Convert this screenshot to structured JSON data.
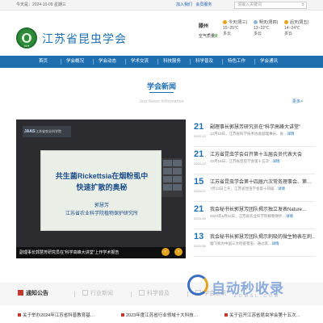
{
  "topbar": {
    "date": "今天是：2024-10-09 星期三",
    "links": [
      "加入我们",
      "会员服务"
    ],
    "search_placeholder": "请输入关键词"
  },
  "header": {
    "site_title": "江苏省昆虫学会",
    "logo_year": "1978",
    "weather": {
      "city": "滕州",
      "air_quality_label": "空气质量",
      "air_quality_value": "良",
      "days": [
        {
          "name": "今天(周三)",
          "temp": "15~25℃",
          "cond": "多云"
        },
        {
          "name": "明天(周四)",
          "temp": "13~22℃",
          "cond": "多云"
        },
        {
          "name": "后天(周五)",
          "temp": "14~24℃",
          "cond": "多云"
        }
      ]
    }
  },
  "nav": {
    "items": [
      "首页",
      "学会概况",
      "学会动态",
      "学术交流",
      "科技服务",
      "科学普及",
      "特色工作",
      "学会通讯"
    ]
  },
  "section": {
    "title": "学会新闻",
    "subtitle": "Jsrs News Information",
    "more": "更多>"
  },
  "feature": {
    "brand": "JAAS",
    "brand_org": "江苏省农业科学院",
    "slide_line1": "共生菌Rickettsia在烟粉虱中",
    "slide_line2": "快速扩散的奥秘",
    "slide_line3": "郭慧芳",
    "slide_line4": "江苏省农业科学院植物保护研究所",
    "caption": "副理事长郭慧芳研究员在“科学高峰大讲堂”上作学术报告",
    "prev": "‹",
    "next": "›"
  },
  "news": [
    {
      "day": "21",
      "ym": "2023-12",
      "title": "副理事长郭慧芳研究员在“科学高峰大讲堂”",
      "desc": "12月19日，江苏省科学技术协会副理事长、省…",
      "detail": "详情"
    },
    {
      "day": "21",
      "ym": "2023-12",
      "title": "江苏省昆虫学会召开第十五届会员代表大会",
      "desc": "12月15日，江苏省昆虫学会第十五次…",
      "detail": "详情"
    },
    {
      "day": "15",
      "ym": "2023-07",
      "title": "江苏省昆虫学会第十四届六次常务理事会、第…",
      "desc": "7月13日上午，江苏省昆虫学会第十四届…",
      "detail": "详情"
    },
    {
      "day": "21",
      "ym": "2023-06",
      "title": "我会秘书长郭慧芳团队揭示独立发表Nature…",
      "desc": "2023年6月10日，江苏省农业科学院植物保护…",
      "detail": "详情"
    },
    {
      "day": "13",
      "ym": "2023-06",
      "title": "我会秘书长郭慧芳团队揭示刺吸的微生物表在刺…",
      "desc": "烟飞虱为中国三大检疫害虫、通过其…",
      "detail": "详情"
    }
  ],
  "tabs": [
    {
      "label": "通知公告",
      "active": true
    },
    {
      "label": "行业新闻",
      "active": false
    },
    {
      "label": "科学普及",
      "active": false
    },
    {
      "label": "学会通讯",
      "active": false
    }
  ],
  "bottom_items": [
    "关于举办2024年江苏省科普教育基…",
    "2023年度江苏省行业领域十大科技…",
    "关于召开江苏省昆虫学会第十五次…"
  ],
  "watermark": {
    "text": "自动秒收录",
    "sub": "ZDMSL.COM"
  },
  "colors": {
    "primary": "#1f6fb0",
    "accent": "#e0a11c",
    "logo_green": "#2d8a3a"
  }
}
